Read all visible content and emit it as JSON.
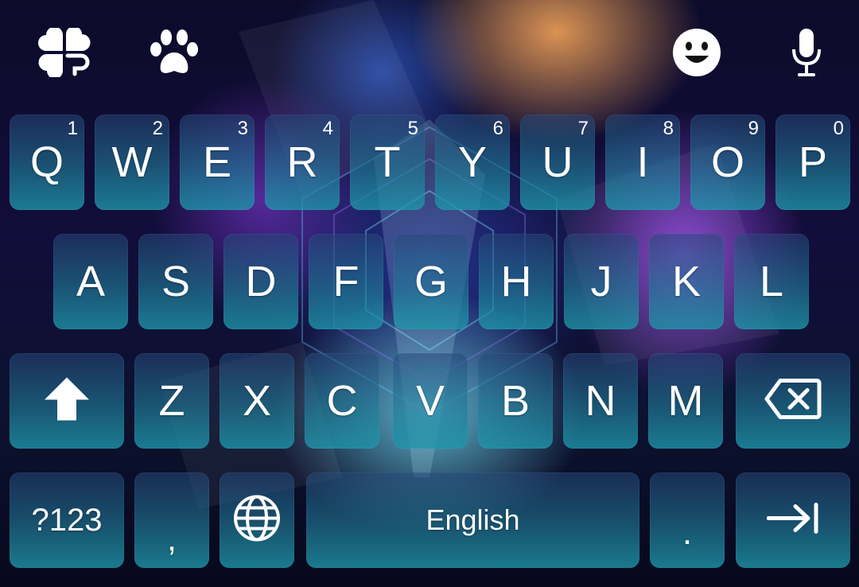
{
  "toolbar": {
    "left_icons": [
      "clover-icon",
      "paw-icon"
    ],
    "right_icons": [
      "emoji-icon",
      "microphone-icon"
    ]
  },
  "keyboard": {
    "row1": [
      {
        "label": "Q",
        "hint": "1"
      },
      {
        "label": "W",
        "hint": "2"
      },
      {
        "label": "E",
        "hint": "3"
      },
      {
        "label": "R",
        "hint": "4"
      },
      {
        "label": "T",
        "hint": "5"
      },
      {
        "label": "Y",
        "hint": "6"
      },
      {
        "label": "U",
        "hint": "7"
      },
      {
        "label": "I",
        "hint": "8"
      },
      {
        "label": "O",
        "hint": "9"
      },
      {
        "label": "P",
        "hint": "0"
      }
    ],
    "row2": [
      "A",
      "S",
      "D",
      "F",
      "G",
      "H",
      "J",
      "K",
      "L"
    ],
    "row3": [
      "Z",
      "X",
      "C",
      "V",
      "B",
      "N",
      "M"
    ],
    "row4": {
      "symbols_label": "?123",
      "comma_label": ",",
      "space_label": "English",
      "period_label": "."
    },
    "special_icons": {
      "shift": "shift-icon",
      "backspace": "backspace-icon",
      "language": "globe-icon",
      "enter": "tab-arrow-icon"
    }
  },
  "colors": {
    "key_top": "#264678",
    "key_bottom": "#1e96aa",
    "text": "#ffffff"
  }
}
